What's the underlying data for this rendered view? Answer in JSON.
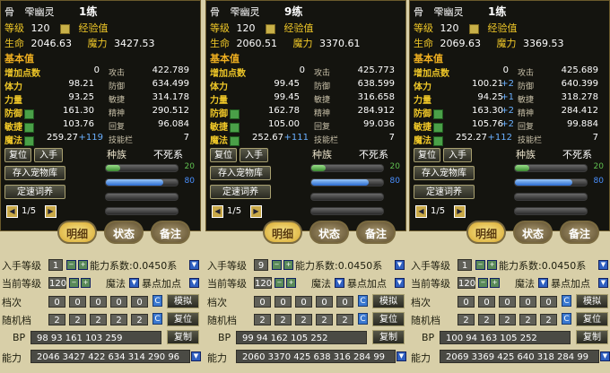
{
  "labels": {
    "level": "等级",
    "exp": "经验值",
    "hp": "生命",
    "mp": "魔力",
    "base": "基本值",
    "points": "增加点数",
    "stamina": "体力",
    "strength": "力量",
    "defense": "防御",
    "agility": "敏捷",
    "magic": "魔法",
    "attack": "攻击",
    "defend": "防御",
    "agi": "敏捷",
    "spirit": "精神",
    "recover": "回复",
    "skills": "技能栏",
    "race": "种族",
    "race_value": "不死系",
    "btn_restore": "复位",
    "btn_take": "入手",
    "btn_store": "存入宠物库",
    "btn_rename": "定速词养",
    "page": "1/5",
    "tab_detail": "明细",
    "tab_state": "状态",
    "tab_note": "备注",
    "calc_level": "入手等级",
    "calc_coef": "能力系数:",
    "calc_coef_value": "0.045",
    "calc_coef_unit": "0系",
    "calc_current": "当前等级",
    "calc_magic": "魔法",
    "calc_crit": "暴点加点",
    "calc_grade": "档次",
    "calc_random": "随机档",
    "calc_bp": "BP",
    "calc_ability": "能力",
    "btn_simulate": "模拟",
    "btn_reset": "复位",
    "btn_copy": "复制",
    "chip_c": "C",
    "bar_hp_value": "20",
    "bar_mp_value": "80"
  },
  "panels": [
    {
      "name_a": "骨",
      "name_b": "雫",
      "name_c": "幽灵",
      "train": "1练",
      "level": "120",
      "hp": "2046.63",
      "mp": "3427.53",
      "points": "0",
      "stamina": "98.21",
      "strength": "93.25",
      "defense": "161.30",
      "agility": "103.76",
      "magic": "259.27",
      "magic_plus": "+119",
      "stamina_plus": "",
      "strength_plus": "",
      "defense_plus": "",
      "agility_plus": "",
      "attack": "422.789",
      "defend": "634.499",
      "agi": "314.178",
      "spirit": "290.512",
      "recover": "96.084",
      "skills": "7",
      "calc_level": "1",
      "calc_current": "120",
      "grade": [
        "0",
        "0",
        "0",
        "0",
        "0"
      ],
      "random": [
        "2",
        "2",
        "2",
        "2",
        "2"
      ],
      "bp": "98 93 161 103 259",
      "ability": "2046 3427 422 634 314 290 96"
    },
    {
      "name_a": "骨",
      "name_b": "雫",
      "name_c": "幽灵",
      "train": "9练",
      "level": "120",
      "hp": "2060.51",
      "mp": "3370.61",
      "points": "0",
      "stamina": "99.45",
      "strength": "99.45",
      "defense": "162.78",
      "agility": "105.00",
      "magic": "252.67",
      "magic_plus": "+111",
      "stamina_plus": "",
      "strength_plus": "",
      "defense_plus": "",
      "agility_plus": "",
      "attack": "425.773",
      "defend": "638.599",
      "agi": "316.658",
      "spirit": "284.912",
      "recover": "99.036",
      "skills": "7",
      "calc_level": "9",
      "calc_current": "120",
      "grade": [
        "0",
        "0",
        "0",
        "0",
        "0"
      ],
      "random": [
        "2",
        "2",
        "2",
        "2",
        "2"
      ],
      "bp": "99 94 162 105 252",
      "ability": "2060 3370 425 638 316 284 99"
    },
    {
      "name_a": "骨",
      "name_b": "雫",
      "name_c": "幽灵",
      "train": "1练",
      "level": "120",
      "hp": "2069.63",
      "mp": "3369.53",
      "points": "0",
      "stamina": "100.21",
      "strength": "94.25",
      "defense": "163.30",
      "agility": "105.76",
      "magic": "252.27",
      "magic_plus": "+112",
      "stamina_plus": "+2",
      "strength_plus": "+1",
      "defense_plus": "+2",
      "agility_plus": "+2",
      "attack": "425.689",
      "defend": "640.399",
      "agi": "318.278",
      "spirit": "284.412",
      "recover": "99.884",
      "skills": "7",
      "calc_level": "1",
      "calc_current": "120",
      "grade": [
        "0",
        "0",
        "0",
        "0",
        "0"
      ],
      "random": [
        "2",
        "2",
        "2",
        "2",
        "2"
      ],
      "bp": "100 94 163 105 252",
      "ability": "2069 3369 425 640 318 284 99"
    }
  ]
}
